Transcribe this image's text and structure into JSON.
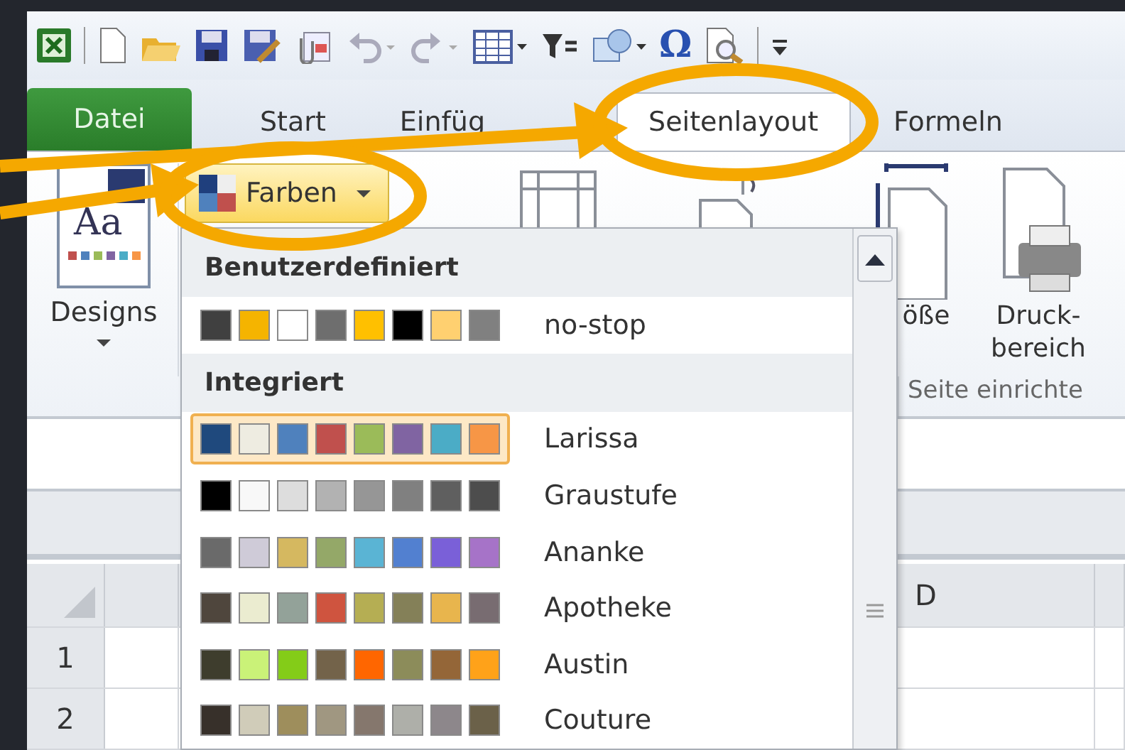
{
  "quick_access_toolbar": {
    "symbol": "Ω"
  },
  "tabs": [
    {
      "label": "Datei",
      "kind": "file",
      "selected": false
    },
    {
      "label": "Start",
      "kind": "tab",
      "selected": false
    },
    {
      "label": "Einfüg",
      "kind": "tab",
      "selected": false
    },
    {
      "label": "Seitenlayout",
      "kind": "tab",
      "selected": true
    },
    {
      "label": "Formeln",
      "kind": "tab",
      "selected": false
    }
  ],
  "ribbon": {
    "designs_button": "Designs",
    "designs_icon_text": "Aa",
    "colors_button": {
      "label": "Farben",
      "expanded": true
    },
    "size_button": "öße",
    "print_area_button": "Druck- bereich",
    "group_label": "Seite einrichte"
  },
  "colors_menu": {
    "sections": [
      {
        "heading": "Benutzerdefiniert",
        "items": [
          {
            "name": "no-stop",
            "selected": false,
            "colors": [
              {
                "color": "#404040"
              },
              {
                "color": "#f5b400"
              },
              {
                "color": "#ffffff"
              },
              {
                "color": "#6e6e6e"
              },
              {
                "color": "#ffc000"
              },
              {
                "color": "#000000"
              },
              {
                "color": "#ffd070"
              },
              {
                "color": "#808080"
              }
            ]
          }
        ]
      },
      {
        "heading": "Integriert",
        "items": [
          {
            "name": "Larissa",
            "selected": true,
            "colors": [
              {
                "color": "#1f497d"
              },
              {
                "color": "#eeece1"
              },
              {
                "color": "#4f81bd"
              },
              {
                "color": "#c0504d"
              },
              {
                "color": "#9bbb59"
              },
              {
                "color": "#8064a2"
              },
              {
                "color": "#4bacc6"
              },
              {
                "color": "#f79646"
              }
            ]
          },
          {
            "name": "Graustufe",
            "selected": false,
            "colors": [
              {
                "color": "#000000"
              },
              {
                "color": "#f8f8f8"
              },
              {
                "color": "#dddddd"
              },
              {
                "color": "#b2b2b2"
              },
              {
                "color": "#969696"
              },
              {
                "color": "#808080"
              },
              {
                "color": "#5f5f5f"
              },
              {
                "color": "#4d4d4d"
              }
            ]
          },
          {
            "name": "Ananke",
            "selected": false,
            "colors": [
              {
                "color": "#6a6a6a"
              },
              {
                "color": "#cfcbd8"
              },
              {
                "color": "#d5b860"
              },
              {
                "color": "#94a868"
              },
              {
                "color": "#5ab4d4"
              },
              {
                "color": "#5280d0"
              },
              {
                "color": "#7a60d8"
              },
              {
                "color": "#a673c8"
              }
            ]
          },
          {
            "name": "Apotheke",
            "selected": false,
            "colors": [
              {
                "color": "#4f463d"
              },
              {
                "color": "#ebecd0"
              },
              {
                "color": "#93a299"
              },
              {
                "color": "#cf543f"
              },
              {
                "color": "#b5ae53"
              },
              {
                "color": "#848058"
              },
              {
                "color": "#e8b54d"
              },
              {
                "color": "#786c71"
              }
            ]
          },
          {
            "name": "Austin",
            "selected": false,
            "colors": [
              {
                "color": "#3e3d2d"
              },
              {
                "color": "#caf278"
              },
              {
                "color": "#84cc18"
              },
              {
                "color": "#73634a"
              },
              {
                "color": "#ff6600"
              },
              {
                "color": "#8c8c5a"
              },
              {
                "color": "#946638"
              },
              {
                "color": "#ffa219"
              }
            ]
          },
          {
            "name": "Couture",
            "selected": false,
            "colors": [
              {
                "color": "#37302a"
              },
              {
                "color": "#d0ccb9"
              },
              {
                "color": "#9e8e5c"
              },
              {
                "color": "#a09781"
              },
              {
                "color": "#85776d"
              },
              {
                "color": "#aeafa9"
              },
              {
                "color": "#8d878b"
              },
              {
                "color": "#6b6149"
              }
            ]
          }
        ]
      }
    ]
  },
  "sheet": {
    "columns": [
      "D"
    ],
    "rows": [
      "1",
      "2"
    ]
  }
}
